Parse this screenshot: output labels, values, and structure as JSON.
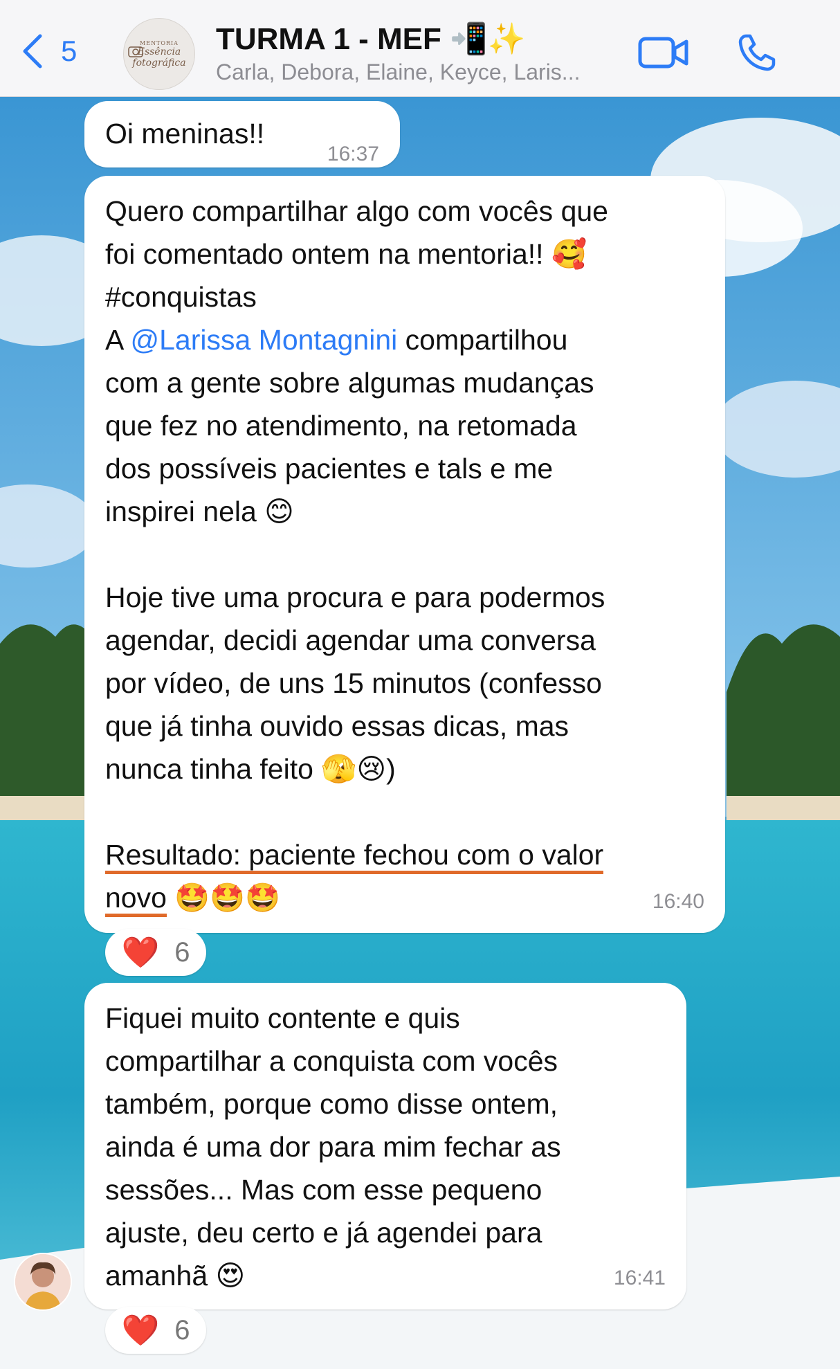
{
  "header": {
    "back_count": "5",
    "title": "TURMA 1 - MEF 📲✨",
    "subtitle": "Carla, Debora, Elaine, Keyce, Laris...",
    "avatar_line1": "MENTORIA",
    "avatar_line2": "Essência",
    "avatar_line3": "fotográfica"
  },
  "messages": [
    {
      "lines": [
        "Oi meninas!!"
      ],
      "time": "16:37"
    },
    {
      "line1": "Quero compartilhar algo com vocês que",
      "line2": "foi comentado ontem na mentoria!! 🥰",
      "line3": "#conquistas",
      "line4_prefix": "A ",
      "line4_mention": "@Larissa Montagnini",
      "line4_suffix": "  compartilhou",
      "line5": "com a gente sobre algumas mudanças",
      "line6": "que fez no atendimento, na retomada",
      "line7": "dos possíveis pacientes e tals e me",
      "line8": "inspirei nela 😊",
      "line9": "Hoje tive uma procura e para podermos",
      "line10": "agendar, decidi agendar uma conversa",
      "line11": "por vídeo, de uns 15 minutos (confesso",
      "line12": "que já tinha ouvido essas dicas, mas",
      "line13": "nunca tinha feito 🫣😢)",
      "line14": "Resultado: paciente fechou com o valor",
      "line15_text": "novo",
      "line15_emoji": " 🤩🤩🤩",
      "time": "16:40",
      "reaction": {
        "emoji": "❤️",
        "count": "6"
      }
    },
    {
      "line1": "Fiquei muito contente e quis",
      "line2": "compartilhar a conquista com vocês",
      "line3": "também, porque como disse ontem,",
      "line4": "ainda é uma dor para mim fechar as",
      "line5": "sessões... Mas com esse pequeno",
      "line6": "ajuste, deu certo e já agendei para",
      "line7": "amanhã 😍",
      "time": "16:41",
      "reaction": {
        "emoji": "❤️",
        "count": "6"
      }
    }
  ],
  "colors": {
    "accent": "#2d7cf6",
    "underline": "#e06a2a",
    "bubble": "#ffffff",
    "header_bg": "#f6f6f8"
  },
  "icons": [
    "chevron-left-icon",
    "video-call-icon",
    "phone-call-icon",
    "camera-logo-icon",
    "heart-icon"
  ]
}
